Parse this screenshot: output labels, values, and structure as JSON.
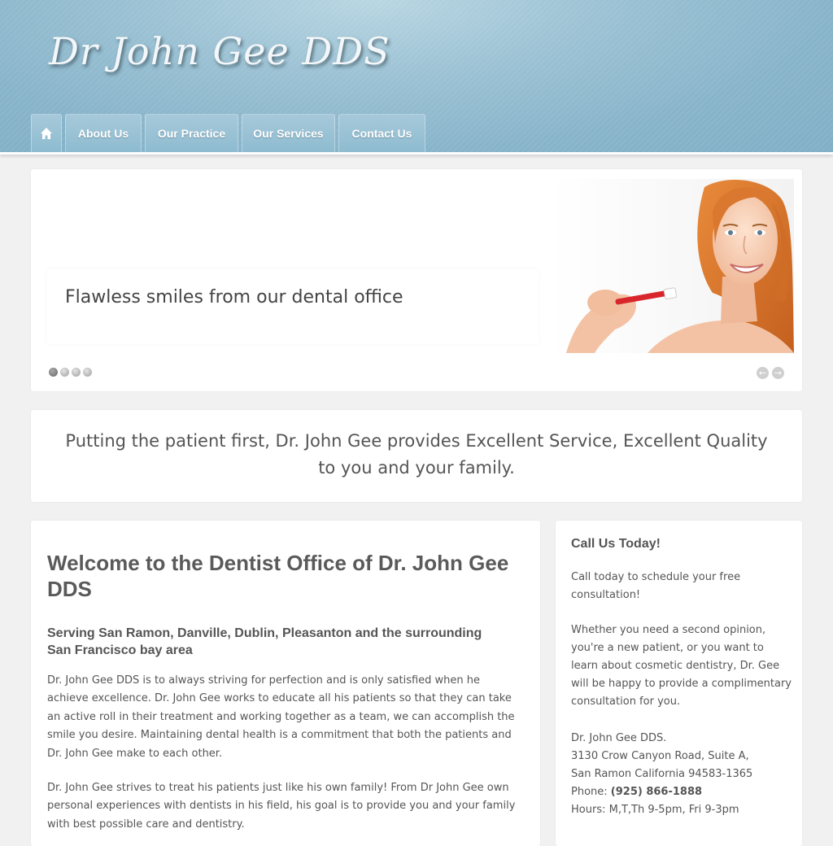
{
  "header": {
    "logo": "Dr John Gee DDS",
    "nav": [
      {
        "label": "",
        "icon": "home-icon"
      },
      {
        "label": "About Us"
      },
      {
        "label": "Our Practice"
      },
      {
        "label": "Our Services"
      },
      {
        "label": "Contact Us"
      }
    ]
  },
  "slider": {
    "caption": "Flawless smiles from our dental office",
    "slide_count": 4,
    "active_slide": 1,
    "image": "woman-brushing-teeth"
  },
  "tagline": "Putting the patient first, Dr. John Gee provides Excellent Service, Excellent Quality to you and your family.",
  "main": {
    "title": "Welcome to the Dentist Office of Dr. John Gee DDS",
    "subtitle": "Serving San Ramon, Danville, Dublin, Pleasanton and the surrounding San Francisco bay area",
    "paragraphs": [
      "Dr. John Gee DDS is to always striving for perfection and is only satisfied when he achieve excellence. Dr. John Gee works to educate all his patients so that they can take an active roll in their treatment and working together as a team, we can accomplish the smile you desire. Maintaining dental health is a commitment that both the patients and Dr. John Gee make to each other.",
      "Dr. John Gee strives to treat his patients just like his own family! From Dr John Gee own personal experiences with dentists in his field, his goal is to provide you and your family with best possible care and dentistry."
    ]
  },
  "sidebar": {
    "title": "Call Us Today!",
    "paragraphs": [
      "Call today to schedule your free consultation!",
      "Whether you need a second opinion, you're a new patient, or you want to learn about cosmetic dentistry, Dr. Gee will be happy to provide a complimentary consultation for you."
    ],
    "address": {
      "name": "Dr. John Gee DDS.",
      "street": "3130 Crow Canyon Road, Suite A,",
      "city": "San Ramon California 94583-1365",
      "phone_label": "Phone: ",
      "phone": "(925) 866-1888",
      "hours": "Hours: M,T,Th 9-5pm, Fri 9-3pm"
    }
  },
  "colors": {
    "header_blue": "#88b4ca",
    "page_bg": "#f1f1f1",
    "text": "#555555",
    "toothbrush_red": "#d8262c",
    "hair": "#d9782e"
  }
}
